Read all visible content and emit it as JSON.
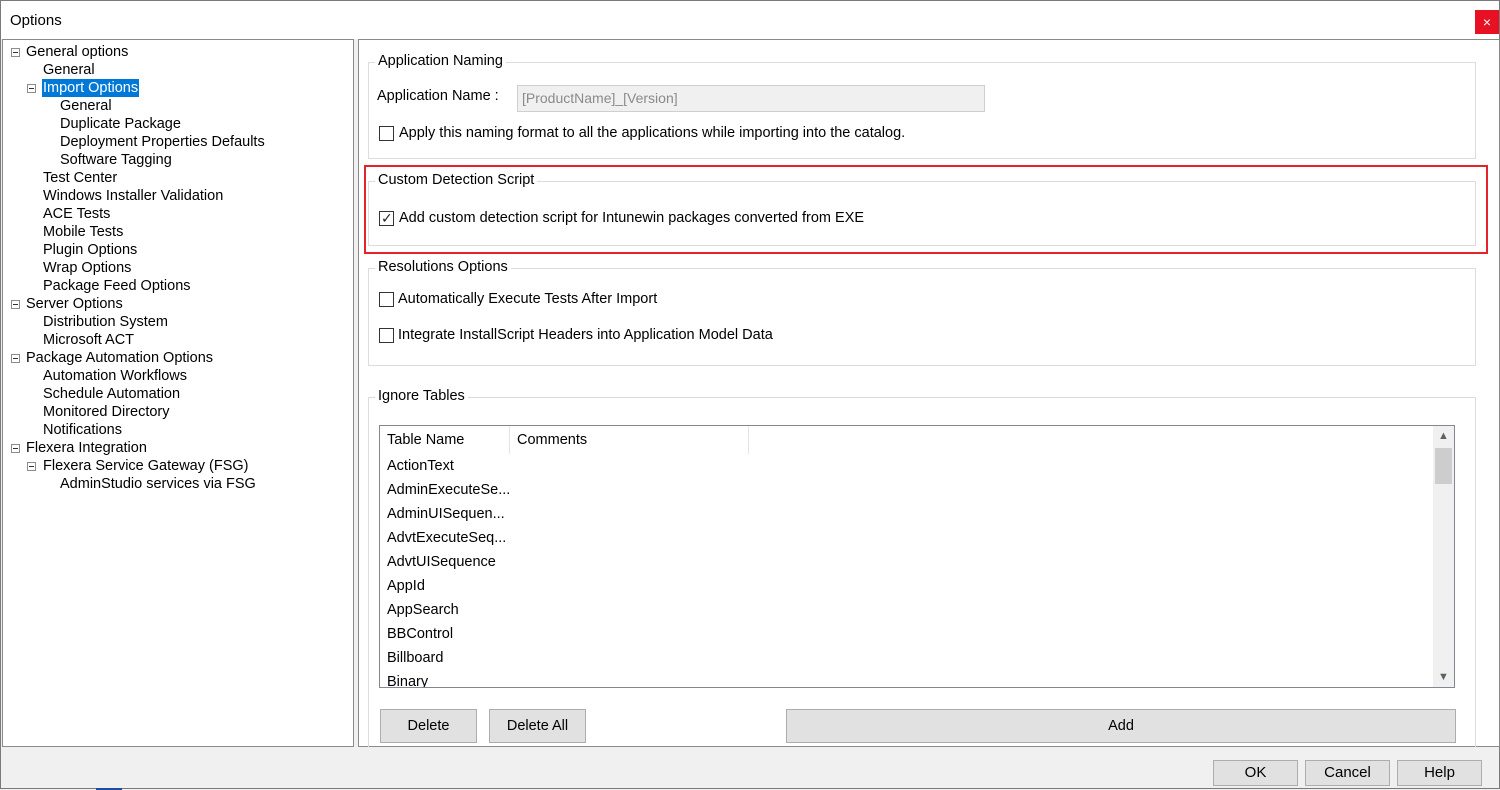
{
  "window": {
    "title": "Options",
    "close_glyph": "×"
  },
  "tree": {
    "selected": "Import Options",
    "items": [
      {
        "label": "General options",
        "level": 0,
        "expander": true
      },
      {
        "label": "General",
        "level": 1,
        "expander": false
      },
      {
        "label": "Import Options",
        "level": 1,
        "expander": true,
        "selected": true
      },
      {
        "label": "General",
        "level": 2,
        "expander": false
      },
      {
        "label": "Duplicate Package",
        "level": 2,
        "expander": false
      },
      {
        "label": "Deployment Properties Defaults",
        "level": 2,
        "expander": false
      },
      {
        "label": "Software Tagging",
        "level": 2,
        "expander": false
      },
      {
        "label": "Test Center",
        "level": 1,
        "expander": false
      },
      {
        "label": "Windows Installer Validation",
        "level": 1,
        "expander": false
      },
      {
        "label": "ACE Tests",
        "level": 1,
        "expander": false
      },
      {
        "label": "Mobile Tests",
        "level": 1,
        "expander": false
      },
      {
        "label": "Plugin Options",
        "level": 1,
        "expander": false
      },
      {
        "label": "Wrap Options",
        "level": 1,
        "expander": false
      },
      {
        "label": "Package Feed Options",
        "level": 1,
        "expander": false
      },
      {
        "label": "Server Options",
        "level": 0,
        "expander": true
      },
      {
        "label": "Distribution System",
        "level": 1,
        "expander": false
      },
      {
        "label": "Microsoft ACT",
        "level": 1,
        "expander": false
      },
      {
        "label": "Package Automation Options",
        "level": 0,
        "expander": true
      },
      {
        "label": "Automation Workflows",
        "level": 1,
        "expander": false
      },
      {
        "label": "Schedule Automation",
        "level": 1,
        "expander": false
      },
      {
        "label": "Monitored Directory",
        "level": 1,
        "expander": false
      },
      {
        "label": "Notifications",
        "level": 1,
        "expander": false
      },
      {
        "label": "Flexera Integration",
        "level": 0,
        "expander": true
      },
      {
        "label": "Flexera Service Gateway (FSG)",
        "level": 1,
        "expander": true
      },
      {
        "label": "AdminStudio services via FSG",
        "level": 2,
        "expander": false
      }
    ]
  },
  "naming": {
    "group_title": "Application Naming",
    "name_label": "Application Name :",
    "name_value": "[ProductName]_[Version]",
    "apply_label": "Apply this naming format to all the applications while importing into the catalog.",
    "apply_checked": false
  },
  "detection": {
    "group_title": "Custom Detection Script",
    "add_label": "Add custom detection script for Intunewin packages converted from EXE",
    "add_checked": true
  },
  "resolutions": {
    "group_title": "Resolutions Options",
    "auto_exec_label": "Automatically Execute Tests After Import",
    "auto_exec_checked": false,
    "integrate_label": "Integrate InstallScript Headers into Application Model Data",
    "integrate_checked": false
  },
  "ignore_tables": {
    "group_title": "Ignore Tables",
    "col_table_name": "Table Name",
    "col_comments": "Comments",
    "rows": [
      "ActionText",
      "AdminExecuteSe...",
      "AdminUISequen...",
      "AdvtExecuteSeq...",
      "AdvtUISequence",
      "AppId",
      "AppSearch",
      "BBControl",
      "Billboard",
      "Binary"
    ],
    "delete_label": "Delete",
    "delete_all_label": "Delete All",
    "add_label": "Add"
  },
  "footer": {
    "ok_label": "OK",
    "cancel_label": "Cancel",
    "help_label": "Help"
  },
  "colors": {
    "selection": "#0078d7",
    "highlight_border": "#e3242b",
    "close": "#e81123"
  },
  "icons": {
    "check": "✓",
    "scroll_up": "▲",
    "scroll_down": "▼",
    "expander": "minus-box-icon"
  }
}
